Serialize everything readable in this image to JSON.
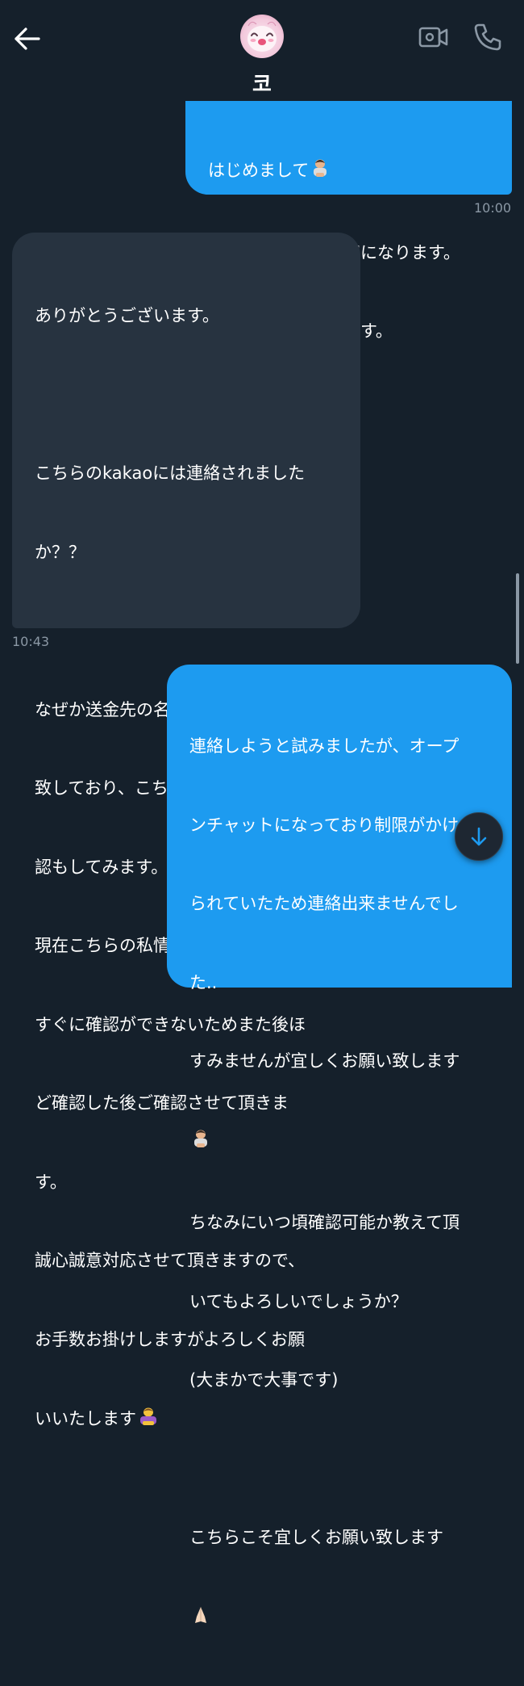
{
  "header": {
    "contact_name": "코",
    "avatar_icon": "pink-cartoon-avatar",
    "back_icon": "arrow-left-icon",
    "video_icon": "video-camera-icon",
    "phone_icon": "phone-icon"
  },
  "messages": [
    {
      "direction": "outgoing",
      "lines": [
        "はじめまして",
        "こちらが全取引内容になります。",
        "ご確認お願い致します。"
      ],
      "emoji_after_line_0": "person-bowing",
      "time": "10:00"
    },
    {
      "direction": "incoming",
      "lines": [
        "ありがとうございます。",
        "",
        "こちらのkakaoには連絡されました",
        "か？？",
        "",
        "なぜか送金先の名前が私の名前と一",
        "致しており、こちらにてWiseの確",
        "認もしてみます。",
        "現在こちらの私情で海外にいまして",
        "すぐに確認ができないためまた後ほ",
        "ど確認した後ご確認させて頂きま",
        "す。",
        "誠心誠意対応させて頂きますので、",
        "お手数お掛けしますがよろしくお願",
        "いいたします"
      ],
      "emoji_last": "person-bowing-gold",
      "time": "10:43"
    },
    {
      "direction": "outgoing",
      "lines": [
        "連絡しようと試みましたが、オープ",
        "ンチャットになっており制限がかけ",
        "られていたため連絡出来ませんでし",
        "た..",
        "すみませんが宜しくお願い致します",
        "",
        "ちなみにいつ頃確認可能か教えて頂",
        "いてもよろしいでしょうか？",
        "(大まかで大事です)",
        "",
        "こちらこそ宜しくお願い致します"
      ],
      "emoji_line_5": "person-bowing",
      "emoji_last": "folded-hands"
    }
  ],
  "scroll_button_icon": "arrow-down-icon",
  "colors": {
    "background": "#15202b",
    "outgoing_bubble": "#1d9bf0",
    "incoming_bubble": "#273340",
    "timestamp": "#8b98a5"
  }
}
